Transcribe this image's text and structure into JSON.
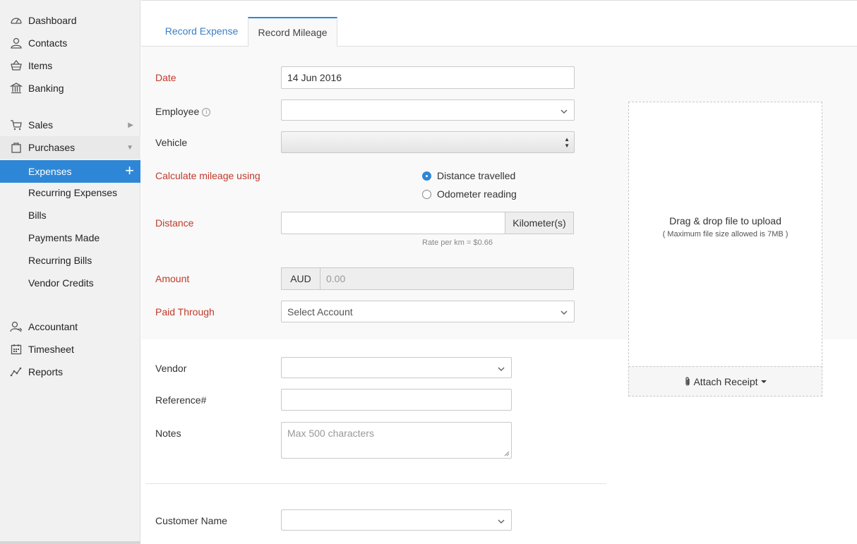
{
  "sidebar": {
    "items": [
      {
        "label": "Dashboard",
        "icon": "dashboard-icon"
      },
      {
        "label": "Contacts",
        "icon": "user-icon"
      },
      {
        "label": "Items",
        "icon": "basket-icon"
      },
      {
        "label": "Banking",
        "icon": "bank-icon"
      },
      {
        "label": "Sales",
        "icon": "cart-icon"
      },
      {
        "label": "Purchases",
        "icon": "bag-icon"
      },
      {
        "label": "Expenses"
      },
      {
        "label": "Recurring Expenses"
      },
      {
        "label": "Bills"
      },
      {
        "label": "Payments Made"
      },
      {
        "label": "Recurring Bills"
      },
      {
        "label": "Vendor Credits"
      },
      {
        "label": "Accountant",
        "icon": "accountant-icon"
      },
      {
        "label": "Timesheet",
        "icon": "calendar-icon"
      },
      {
        "label": "Reports",
        "icon": "chart-icon"
      }
    ],
    "active_item": "Expenses",
    "active_color": "#2e87d6"
  },
  "tabs": {
    "record_expense": "Record Expense",
    "record_mileage": "Record Mileage"
  },
  "form": {
    "date": {
      "label": "Date",
      "value": "14 Jun 2016"
    },
    "employee": {
      "label": "Employee",
      "value": ""
    },
    "vehicle": {
      "label": "Vehicle",
      "value": ""
    },
    "calc": {
      "label": "Calculate mileage using",
      "options": [
        "Distance travelled",
        "Odometer reading"
      ],
      "selected": "Distance travelled"
    },
    "distance": {
      "label": "Distance",
      "value": "",
      "unit": "Kilometer(s)",
      "hint": "Rate per km = $0.66"
    },
    "amount": {
      "label": "Amount",
      "currency": "AUD",
      "placeholder": "0.00"
    },
    "paid_through": {
      "label": "Paid Through",
      "placeholder": "Select Account"
    },
    "vendor": {
      "label": "Vendor",
      "value": ""
    },
    "reference": {
      "label": "Reference#",
      "value": ""
    },
    "notes": {
      "label": "Notes",
      "placeholder": "Max 500 characters"
    },
    "customer": {
      "label": "Customer Name",
      "value": ""
    }
  },
  "upload": {
    "title": "Drag & drop file to upload",
    "subtitle": "( Maximum file size allowed is 7MB )",
    "attach_label": "Attach Receipt"
  },
  "colors": {
    "required_label": "#c0392b",
    "link": "#3a7fc4"
  }
}
